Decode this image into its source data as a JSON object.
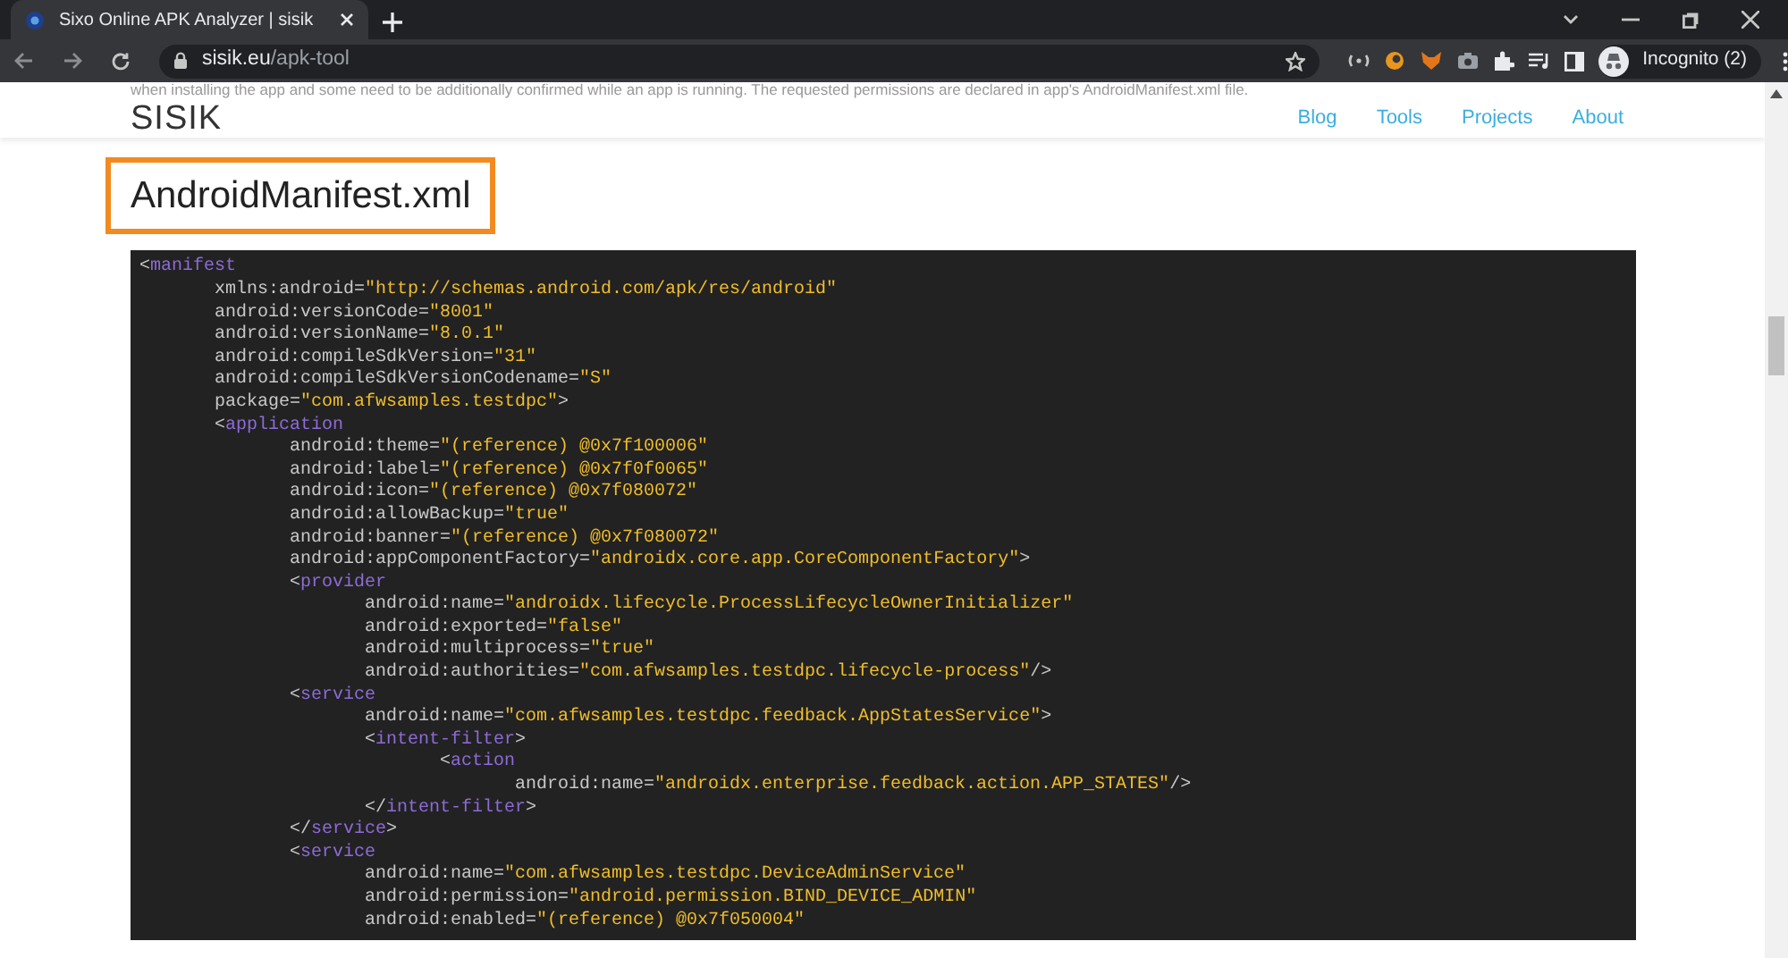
{
  "browser": {
    "tab": {
      "title": "Sixo Online APK Analyzer | sisik"
    },
    "address": {
      "domain": "sisik.eu",
      "path": "/apk-tool"
    },
    "profile": {
      "label": "Incognito (2)"
    }
  },
  "page": {
    "faded_text": "when installing the app and some need to be additionally confirmed while an app is running. The requested permissions are declared in app's AndroidManifest.xml file.",
    "navbar": {
      "brand": "SISIK",
      "links": [
        {
          "label": "Blog"
        },
        {
          "label": "Tools"
        },
        {
          "label": "Projects"
        },
        {
          "label": "About"
        }
      ]
    },
    "heading": "AndroidManifest.xml",
    "code": {
      "lines": [
        {
          "segments": [
            {
              "kind": "punct",
              "text": "<"
            },
            {
              "kind": "tag",
              "text": "manifest"
            }
          ]
        },
        {
          "segments": [
            {
              "kind": "attr",
              "text": "\txmlns:android="
            },
            {
              "kind": "value",
              "text": "\"http://schemas.android.com/apk/res/android\""
            }
          ]
        },
        {
          "segments": [
            {
              "kind": "attr",
              "text": "\tandroid:versionCode="
            },
            {
              "kind": "value",
              "text": "\"8001\""
            }
          ]
        },
        {
          "segments": [
            {
              "kind": "attr",
              "text": "\tandroid:versionName="
            },
            {
              "kind": "value",
              "text": "\"8.0.1\""
            }
          ]
        },
        {
          "segments": [
            {
              "kind": "attr",
              "text": "\tandroid:compileSdkVersion="
            },
            {
              "kind": "value",
              "text": "\"31\""
            }
          ]
        },
        {
          "segments": [
            {
              "kind": "attr",
              "text": "\tandroid:compileSdkVersionCodename="
            },
            {
              "kind": "value",
              "text": "\"S\""
            }
          ]
        },
        {
          "segments": [
            {
              "kind": "attr",
              "text": "\tpackage="
            },
            {
              "kind": "value",
              "text": "\"com.afwsamples.testdpc\""
            },
            {
              "kind": "punct",
              "text": ">"
            }
          ]
        },
        {
          "segments": [
            {
              "kind": "punct",
              "text": "\t<"
            },
            {
              "kind": "tag",
              "text": "application"
            }
          ]
        },
        {
          "segments": [
            {
              "kind": "attr",
              "text": "\t\tandroid:theme="
            },
            {
              "kind": "value",
              "text": "\"(reference) @0x7f100006\""
            }
          ]
        },
        {
          "segments": [
            {
              "kind": "attr",
              "text": "\t\tandroid:label="
            },
            {
              "kind": "value",
              "text": "\"(reference) @0x7f0f0065\""
            }
          ]
        },
        {
          "segments": [
            {
              "kind": "attr",
              "text": "\t\tandroid:icon="
            },
            {
              "kind": "value",
              "text": "\"(reference) @0x7f080072\""
            }
          ]
        },
        {
          "segments": [
            {
              "kind": "attr",
              "text": "\t\tandroid:allowBackup="
            },
            {
              "kind": "value",
              "text": "\"true\""
            }
          ]
        },
        {
          "segments": [
            {
              "kind": "attr",
              "text": "\t\tandroid:banner="
            },
            {
              "kind": "value",
              "text": "\"(reference) @0x7f080072\""
            }
          ]
        },
        {
          "segments": [
            {
              "kind": "attr",
              "text": "\t\tandroid:appComponentFactory="
            },
            {
              "kind": "value",
              "text": "\"androidx.core.app.CoreComponentFactory\""
            },
            {
              "kind": "punct",
              "text": ">"
            }
          ]
        },
        {
          "segments": [
            {
              "kind": "punct",
              "text": "\t\t<"
            },
            {
              "kind": "tag",
              "text": "provider"
            }
          ]
        },
        {
          "segments": [
            {
              "kind": "attr",
              "text": "\t\t\tandroid:name="
            },
            {
              "kind": "value",
              "text": "\"androidx.lifecycle.ProcessLifecycleOwnerInitializer\""
            }
          ]
        },
        {
          "segments": [
            {
              "kind": "attr",
              "text": "\t\t\tandroid:exported="
            },
            {
              "kind": "value",
              "text": "\"false\""
            }
          ]
        },
        {
          "segments": [
            {
              "kind": "attr",
              "text": "\t\t\tandroid:multiprocess="
            },
            {
              "kind": "value",
              "text": "\"true\""
            }
          ]
        },
        {
          "segments": [
            {
              "kind": "attr",
              "text": "\t\t\tandroid:authorities="
            },
            {
              "kind": "value",
              "text": "\"com.afwsamples.testdpc.lifecycle-process\""
            },
            {
              "kind": "punct",
              "text": "/>"
            }
          ]
        },
        {
          "segments": [
            {
              "kind": "punct",
              "text": "\t\t<"
            },
            {
              "kind": "tag",
              "text": "service"
            }
          ]
        },
        {
          "segments": [
            {
              "kind": "attr",
              "text": "\t\t\tandroid:name="
            },
            {
              "kind": "value",
              "text": "\"com.afwsamples.testdpc.feedback.AppStatesService\""
            },
            {
              "kind": "punct",
              "text": ">"
            }
          ]
        },
        {
          "segments": [
            {
              "kind": "punct",
              "text": "\t\t\t<"
            },
            {
              "kind": "tag",
              "text": "intent-filter"
            },
            {
              "kind": "punct",
              "text": ">"
            }
          ]
        },
        {
          "segments": [
            {
              "kind": "punct",
              "text": "\t\t\t\t<"
            },
            {
              "kind": "tag",
              "text": "action"
            }
          ]
        },
        {
          "segments": [
            {
              "kind": "attr",
              "text": "\t\t\t\t\tandroid:name="
            },
            {
              "kind": "value",
              "text": "\"androidx.enterprise.feedback.action.APP_STATES\""
            },
            {
              "kind": "punct",
              "text": "/>"
            }
          ]
        },
        {
          "segments": [
            {
              "kind": "punct",
              "text": "\t\t\t</"
            },
            {
              "kind": "tag",
              "text": "intent-filter"
            },
            {
              "kind": "punct",
              "text": ">"
            }
          ]
        },
        {
          "segments": [
            {
              "kind": "punct",
              "text": "\t\t</"
            },
            {
              "kind": "tag",
              "text": "service"
            },
            {
              "kind": "punct",
              "text": ">"
            }
          ]
        },
        {
          "segments": [
            {
              "kind": "punct",
              "text": "\t\t<"
            },
            {
              "kind": "tag",
              "text": "service"
            }
          ]
        },
        {
          "segments": [
            {
              "kind": "attr",
              "text": "\t\t\tandroid:name="
            },
            {
              "kind": "value",
              "text": "\"com.afwsamples.testdpc.DeviceAdminService\""
            }
          ]
        },
        {
          "segments": [
            {
              "kind": "attr",
              "text": "\t\t\tandroid:permission="
            },
            {
              "kind": "value",
              "text": "\"android.permission.BIND_DEVICE_ADMIN\""
            }
          ]
        },
        {
          "segments": [
            {
              "kind": "attr",
              "text": "\t\t\tandroid:enabled="
            },
            {
              "kind": "value",
              "text": "\"(reference) @0x7f050004\""
            }
          ]
        }
      ]
    }
  }
}
